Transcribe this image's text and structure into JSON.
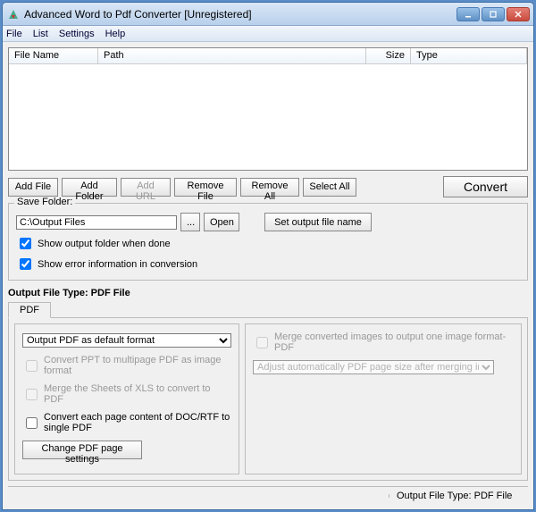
{
  "window": {
    "title": "Advanced Word to Pdf Converter [Unregistered]"
  },
  "menu": {
    "file": "File",
    "list": "List",
    "settings": "Settings",
    "help": "Help"
  },
  "columns": {
    "filename": "File Name",
    "path": "Path",
    "size": "Size",
    "type": "Type"
  },
  "toolbar": {
    "addFile": "Add File",
    "addFolder": "Add Folder",
    "addUrl": "Add URL",
    "removeFile": "Remove File",
    "removeAll": "Remove All",
    "selectAll": "Select All",
    "convert": "Convert"
  },
  "saveFolder": {
    "legend": "Save Folder:",
    "path": "C:\\Output Files",
    "browse": "...",
    "open": "Open",
    "setOutput": "Set output file name",
    "showFolder": "Show output folder when done",
    "showError": "Show error information in conversion"
  },
  "outputType": {
    "label": "Output File Type:  PDF File",
    "tab": "PDF"
  },
  "pdf": {
    "defaultFormat": "Output PDF as default format",
    "ppt": "Convert PPT to multipage PDF as image format",
    "xls": "Merge the Sheets of XLS to convert to PDF",
    "docrtf": "Convert each page content of DOC/RTF to single PDF",
    "pageSettings": "Change PDF page settings",
    "mergeImages": "Merge converted images to output one image format-PDF",
    "adjustSize": "Adjust automatically PDF page size after merging images to PDF"
  },
  "statusbar": {
    "outputType": "Output File Type:  PDF File"
  }
}
